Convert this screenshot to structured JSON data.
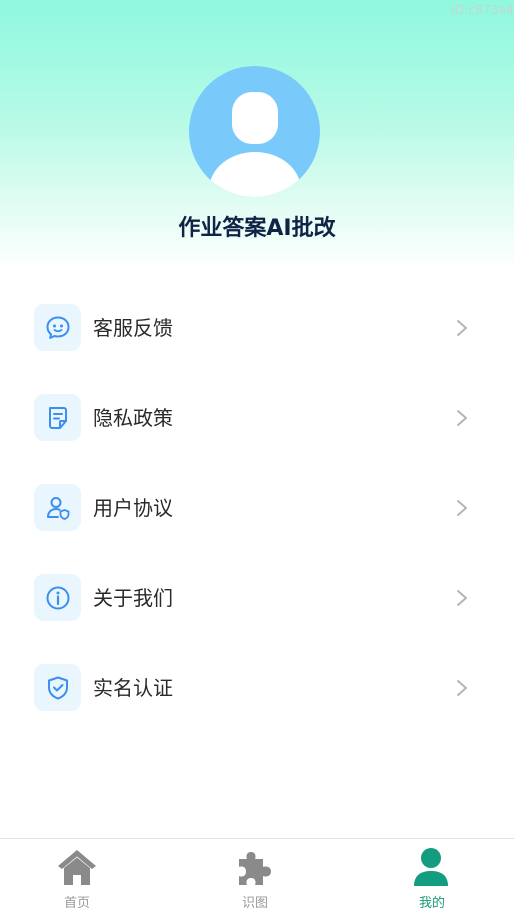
{
  "id_tag": "ID:c873a4",
  "app_name": "作业答案AI批改",
  "menu": [
    {
      "label": "客服反馈",
      "icon": "chat-face-icon"
    },
    {
      "label": "隐私政策",
      "icon": "document-icon"
    },
    {
      "label": "用户协议",
      "icon": "user-shield-icon"
    },
    {
      "label": "关于我们",
      "icon": "info-icon"
    },
    {
      "label": "实名认证",
      "icon": "shield-check-icon"
    }
  ],
  "tabs": [
    {
      "label": "首页",
      "icon": "home-icon",
      "active": false
    },
    {
      "label": "识图",
      "icon": "puzzle-icon",
      "active": false
    },
    {
      "label": "我的",
      "icon": "person-icon",
      "active": true
    }
  ],
  "colors": {
    "accent_blue": "#3b8ff0",
    "tab_active": "#1a9a7a",
    "tab_inactive": "#8a8a8a",
    "avatar_bg": "#7ac9fb"
  }
}
